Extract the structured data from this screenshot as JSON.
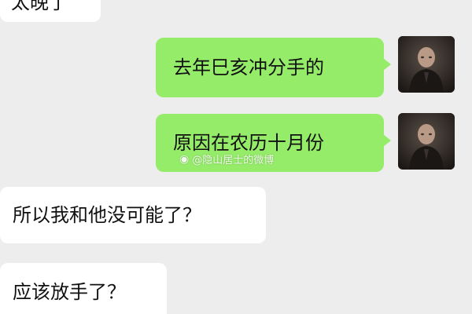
{
  "messages": [
    {
      "side": "left",
      "text": "太晚了"
    },
    {
      "side": "right",
      "text": "去年巳亥冲分手的"
    },
    {
      "side": "right",
      "text": "原因在农历十月份"
    },
    {
      "side": "left",
      "text": "所以我和他没可能了？"
    },
    {
      "side": "left",
      "text": "应该放手了？"
    }
  ],
  "watermark": {
    "icon": "weibo-icon",
    "text": "@隐山居士的微博"
  },
  "colors": {
    "background": "#ededed",
    "sent_bubble": "#95ec69",
    "received_bubble": "#ffffff"
  }
}
